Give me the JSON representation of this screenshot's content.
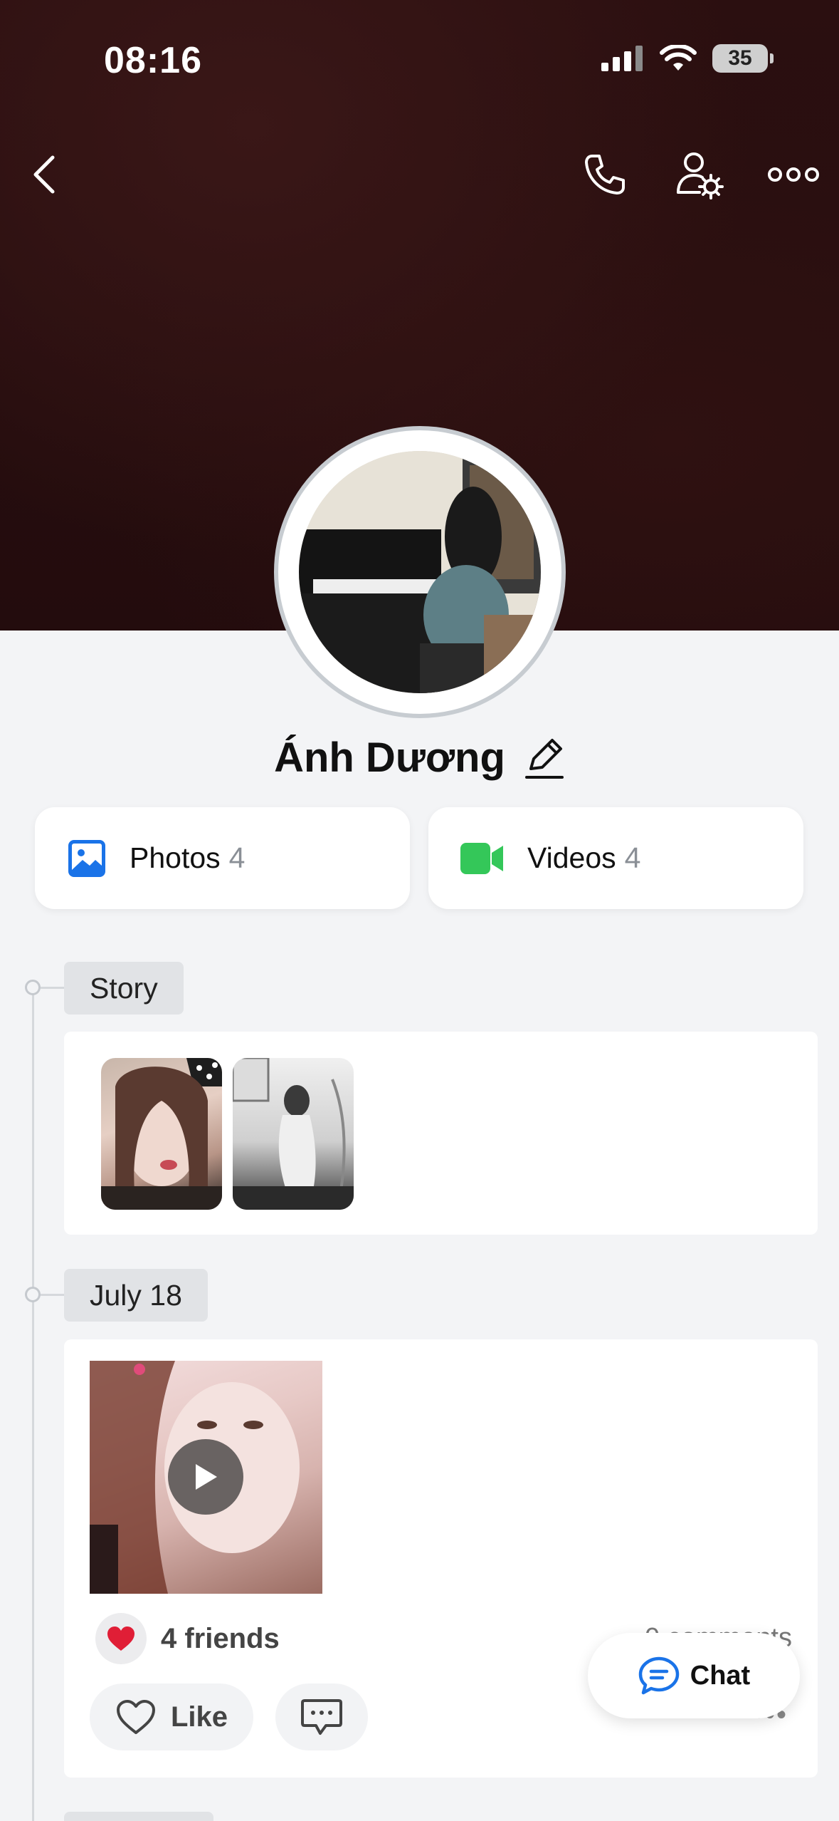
{
  "status_bar": {
    "time": "08:16",
    "battery": "35"
  },
  "header": {
    "icons": [
      "back-icon",
      "phone-icon",
      "user-settings-icon",
      "more-icon"
    ]
  },
  "profile": {
    "name": "Ánh Dương"
  },
  "media": {
    "photos": {
      "label": "Photos",
      "count": "4",
      "icon": "photos-icon",
      "color": "#1a73e8"
    },
    "videos": {
      "label": "Videos",
      "count": "4",
      "icon": "video-icon",
      "color": "#34c759"
    }
  },
  "timeline": {
    "story_label": "Story",
    "date_label": "July 18"
  },
  "post": {
    "reaction_count": "4 friends",
    "comments": "0 comments",
    "like_label": "Like"
  },
  "chat_fab": {
    "label": "Chat",
    "color": "#1a73e8"
  }
}
